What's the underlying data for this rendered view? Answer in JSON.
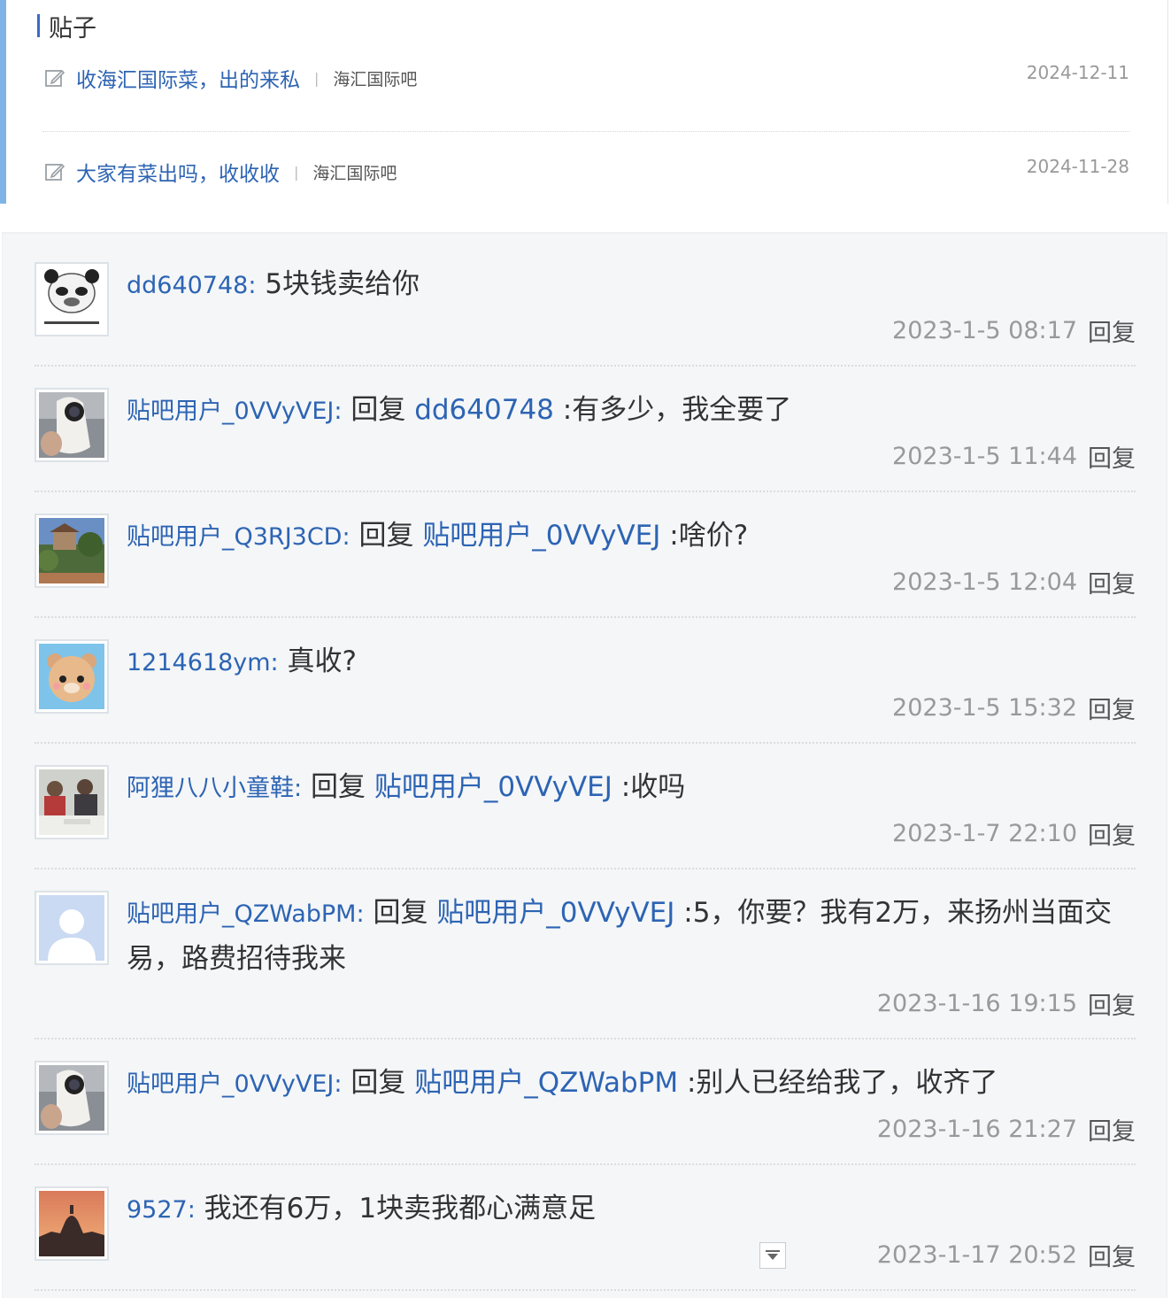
{
  "posts_section": {
    "title": "贴子",
    "posts": [
      {
        "title": "收海汇国际菜，出的来私",
        "separator": "|",
        "forum": "海汇国际吧",
        "date": "2024-12-11"
      },
      {
        "title": "大家有菜出吗，收收收",
        "separator": "|",
        "forum": "海汇国际吧",
        "date": "2024-11-28"
      }
    ]
  },
  "replies": {
    "reply_label": "回复",
    "items": [
      {
        "user": "dd640748",
        "colon": ":",
        "prefix": "",
        "target": "",
        "content": " 5块钱卖给你",
        "time": "2023-1-5 08:17",
        "avatar_icon": "panda-meme-avatar"
      },
      {
        "user": "贴吧用户_0VVyVEJ",
        "colon": ":",
        "prefix": " 回复 ",
        "target": "dd640748",
        "content": " :有多少，我全要了",
        "time": "2023-1-5 11:44",
        "avatar_icon": "camera-avatar"
      },
      {
        "user": "贴吧用户_Q3RJ3CD",
        "colon": ":",
        "prefix": " 回复 ",
        "target": "贴吧用户_0VVyVEJ",
        "content": " :啥价?",
        "time": "2023-1-5 12:04",
        "avatar_icon": "landscape-avatar"
      },
      {
        "user": "1214618ym",
        "colon": ":",
        "prefix": "",
        "target": "",
        "content": " 真收?",
        "time": "2023-1-5 15:32",
        "avatar_icon": "bear-avatar"
      },
      {
        "user": "阿狸八八小童鞋",
        "colon": ":",
        "prefix": " 回复 ",
        "target": "贴吧用户_0VVyVEJ",
        "content": " :收吗",
        "time": "2023-1-7 22:10",
        "avatar_icon": "people-photo-avatar"
      },
      {
        "user": "贴吧用户_QZWabPM",
        "colon": ":",
        "prefix": " 回复 ",
        "target": "贴吧用户_0VVyVEJ",
        "content": " :5，你要？我有2万，来扬州当面交易，路费招待我来",
        "time": "2023-1-16 19:15",
        "avatar_icon": "default-user-avatar"
      },
      {
        "user": "贴吧用户_0VVyVEJ",
        "colon": ":",
        "prefix": " 回复 ",
        "target": "贴吧用户_QZWabPM",
        "content": " :别人已经给我了，收齐了",
        "time": "2023-1-16 21:27",
        "avatar_icon": "camera-avatar"
      },
      {
        "user": "9527",
        "colon": ":",
        "prefix": "",
        "target": "",
        "content": " 我还有6万，1块卖我都心满意足",
        "time": "2023-1-17 20:52",
        "avatar_icon": "sunset-city-avatar"
      }
    ]
  },
  "colors": {
    "link": "#2d64b3",
    "muted": "#999999",
    "accent_bar": "#7fb3e6",
    "panel_bg": "#f4f6f8"
  }
}
